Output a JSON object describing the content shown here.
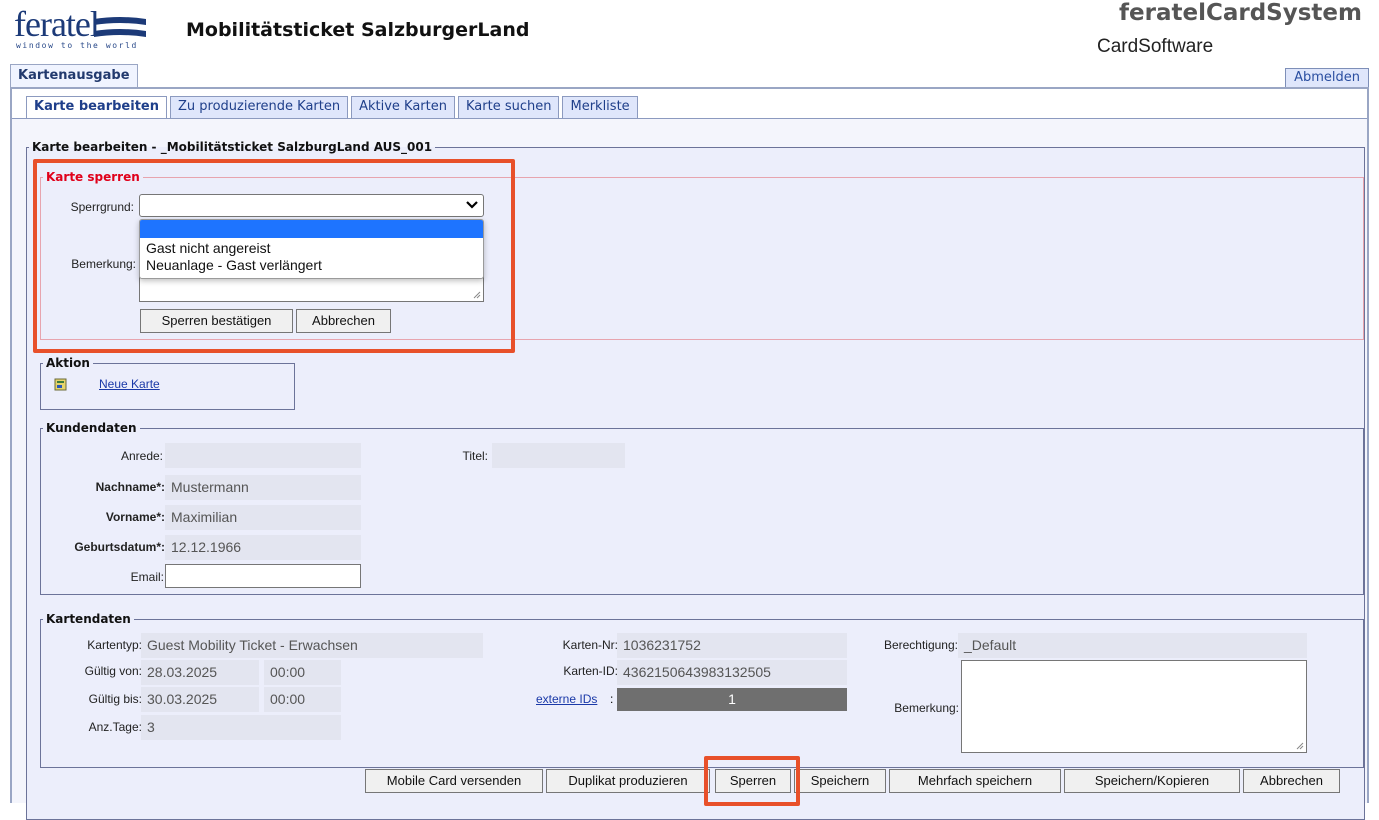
{
  "header": {
    "logo_text": "feratel",
    "logo_tagline": "window to the world",
    "app_title": "Mobilitätsticket SalzburgerLand",
    "brand_title": "feratelCardSystem",
    "brand_subtitle": "CardSoftware",
    "top_tab": "Kartenausgabe",
    "logout_label": "Abmelden"
  },
  "tabs": [
    {
      "label": "Karte bearbeiten",
      "active": true
    },
    {
      "label": "Zu produzierende Karten"
    },
    {
      "label": "Aktive Karten"
    },
    {
      "label": "Karte suchen"
    },
    {
      "label": "Merkliste"
    }
  ],
  "main": {
    "title": "Karte bearbeiten - _Mobilitätsticket SalzburgLand AUS_001"
  },
  "sperren": {
    "title": "Karte sperren",
    "title_color": "#e0001a",
    "grund_label": "Sperrgrund:",
    "grund_value": "",
    "options": [
      "Gast nicht angereist",
      "Neuanlage - Gast verlängert"
    ],
    "bemerkung_label": "Bemerkung:",
    "confirm_label": "Sperren bestätigen",
    "cancel_label": "Abbrechen",
    "highlight_color": "#e8502a"
  },
  "aktion": {
    "title": "Aktion",
    "neue_karte": "Neue Karte",
    "icon": "new-card-icon"
  },
  "kundendaten": {
    "title": "Kundendaten",
    "anrede_label": "Anrede:",
    "anrede_value": "",
    "titel_label": "Titel:",
    "titel_value": "",
    "nachname_label": "Nachname*:",
    "nachname_value": "Mustermann",
    "vorname_label": "Vorname*:",
    "vorname_value": "Maximilian",
    "geburtsdatum_label": "Geburtsdatum*:",
    "geburtsdatum_value": "12.12.1966",
    "email_label": "Email:",
    "email_value": ""
  },
  "kartendaten": {
    "title": "Kartendaten",
    "kartentyp_label": "Kartentyp:",
    "kartentyp_value": "Guest Mobility Ticket - Erwachsen",
    "gueltig_von_label": "Gültig von:",
    "gueltig_von_date": "28.03.2025",
    "gueltig_von_time": "00:00",
    "gueltig_bis_label": "Gültig bis:",
    "gueltig_bis_date": "30.03.2025",
    "gueltig_bis_time": "00:00",
    "anz_tage_label": "Anz.Tage:",
    "anz_tage_value": "3",
    "karten_nr_label": "Karten-Nr:",
    "karten_nr_value": "1036231752",
    "karten_id_label": "Karten-ID:",
    "karten_id_value": "4362150643983132505",
    "externe_ids_label": "externe IDs",
    "externe_ids_value": "1",
    "berechtigung_label": "Berechtigung:",
    "berechtigung_value": "_Default",
    "bemerkung_label": "Bemerkung:"
  },
  "actions": {
    "mobile_card": "Mobile Card versenden",
    "duplikat": "Duplikat produzieren",
    "sperren": "Sperren",
    "speichern": "Speichern",
    "mehrfach": "Mehrfach speichern",
    "speichern_kopieren": "Speichern/Kopieren",
    "abbrechen": "Abbrechen"
  }
}
